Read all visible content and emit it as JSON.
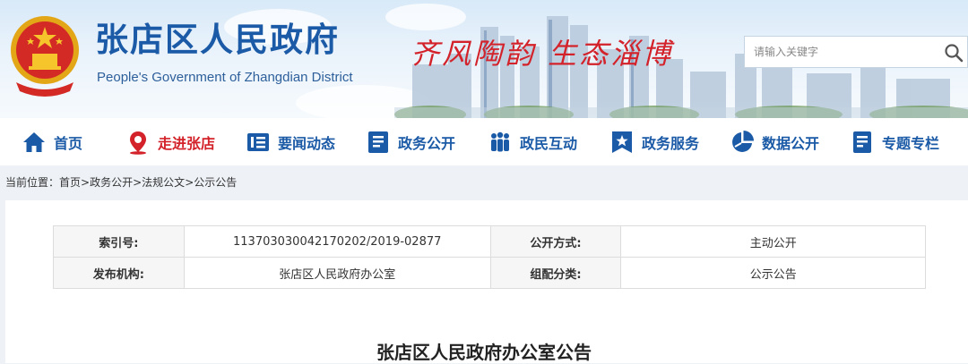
{
  "header": {
    "title": "张店区人民政府",
    "subtitle": "People's Government of Zhangdian District",
    "slogan": "齐风陶韵 生态淄博",
    "search": {
      "placeholder": "请输入关键字",
      "icon": "search-icon"
    }
  },
  "nav": {
    "items": [
      {
        "label": "首页",
        "icon": "home-icon"
      },
      {
        "label": "走进张店",
        "icon": "location-pin-icon",
        "active": true
      },
      {
        "label": "要闻动态",
        "icon": "news-icon"
      },
      {
        "label": "政务公开",
        "icon": "document-icon"
      },
      {
        "label": "政民互动",
        "icon": "people-icon"
      },
      {
        "label": "政务服务",
        "icon": "star-bookmark-icon"
      },
      {
        "label": "数据公开",
        "icon": "pie-chart-icon"
      },
      {
        "label": "专题专栏",
        "icon": "topic-icon"
      }
    ]
  },
  "breadcrumb": {
    "prefix": "当前位置：",
    "items": [
      "首页",
      "政务公开",
      "法规公文",
      "公示公告"
    ],
    "separator": ">"
  },
  "document": {
    "meta": [
      {
        "label": "索引号:",
        "value": "113703030042170202/2019-02877",
        "label2": "公开方式:",
        "value2": "主动公开"
      },
      {
        "label": "发布机构:",
        "value": "张店区人民政府办公室",
        "label2": "组配分类:",
        "value2": "公示公告"
      }
    ],
    "title": "张店区人民政府办公室公告"
  },
  "colors": {
    "brand_blue": "#1b5aa6",
    "accent_red": "#d3222a",
    "page_bg": "#eef2f7"
  }
}
